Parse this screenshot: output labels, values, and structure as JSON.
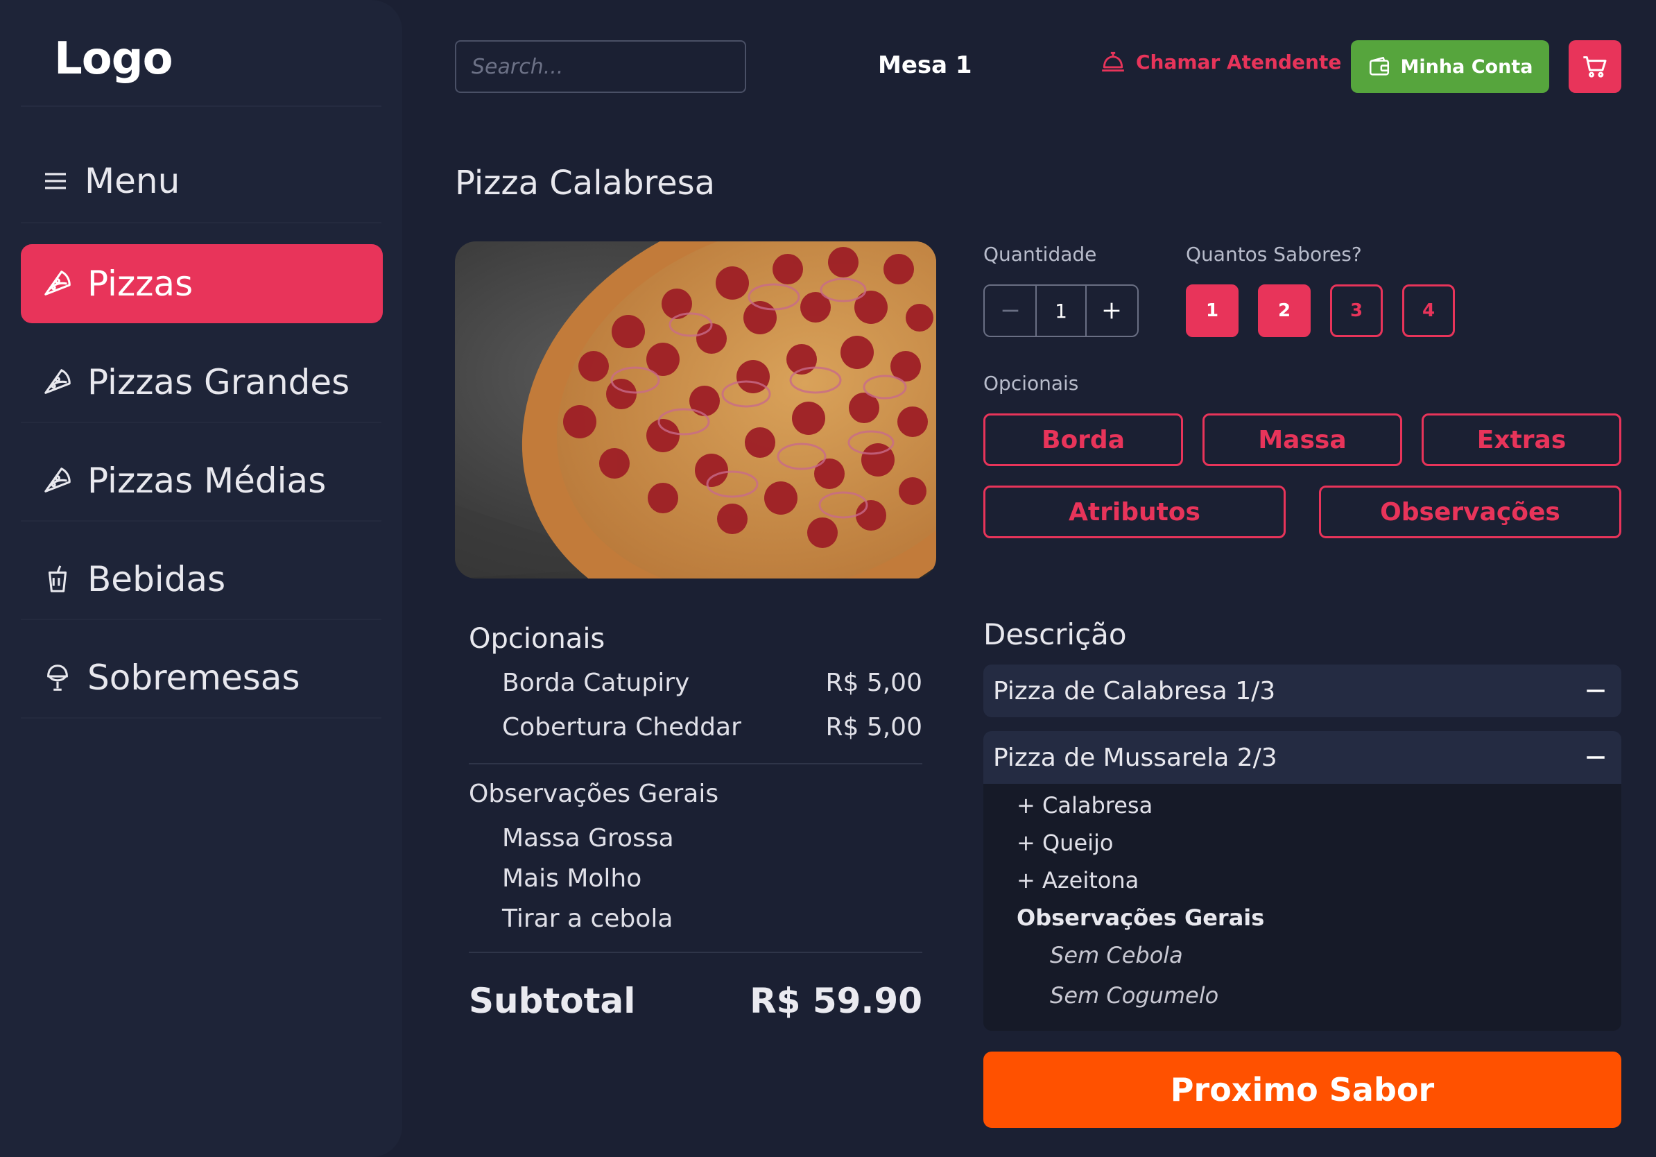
{
  "sidebar": {
    "logo": "Logo",
    "menu_label": "Menu",
    "items": [
      {
        "label": "Pizzas",
        "icon": "pizza-slice-icon"
      },
      {
        "label": "Pizzas Grandes",
        "icon": "pizza-slice-icon"
      },
      {
        "label": "Pizzas Médias",
        "icon": "pizza-slice-icon"
      },
      {
        "label": "Bebidas",
        "icon": "drink-cup-icon"
      },
      {
        "label": "Sobremesas",
        "icon": "ice-cream-icon"
      }
    ],
    "active_index": 0
  },
  "header": {
    "search_placeholder": "Search...",
    "table": "Mesa 1",
    "call_waiter": "Chamar Atendente",
    "account": "Minha Conta"
  },
  "product": {
    "title": "Pizza Calabresa",
    "quantity_label": "Quantidade",
    "quantity": "1",
    "flavors_label": "Quantos Sabores?",
    "flavor_options": [
      "1",
      "2",
      "3",
      "4"
    ],
    "optionals_label": "Opcionais",
    "optional_buttons": [
      "Borda",
      "Massa",
      "Extras",
      "Atributos",
      "Observações"
    ]
  },
  "summary": {
    "optionals_title": "Opcionais",
    "optionals": [
      {
        "name": "Borda Catupiry",
        "price": "R$ 5,00"
      },
      {
        "name": "Cobertura Cheddar",
        "price": "R$ 5,00"
      }
    ],
    "observations_title": "Observações Gerais",
    "observations": [
      "Massa Grossa",
      "Mais Molho",
      "Tirar a cebola"
    ],
    "subtotal_label": "Subtotal",
    "subtotal_value": "R$ 59.90"
  },
  "description": {
    "title": "Descrição",
    "flavors": [
      {
        "name": "Pizza de Calabresa 1/3"
      },
      {
        "name": "Pizza de Mussarela 2/3"
      }
    ],
    "expanded_items": [
      "+ Calabresa",
      "+ Queijo",
      "+ Azeitona"
    ],
    "obs_title": "Observações Gerais",
    "obs_items": [
      "Sem Cebola",
      "Sem Cogumelo"
    ]
  },
  "next_button": "Proximo Sabor",
  "colors": {
    "background": "#1b2033",
    "accent": "#e8345a",
    "green": "#56a53d",
    "orange": "#ff5100"
  }
}
